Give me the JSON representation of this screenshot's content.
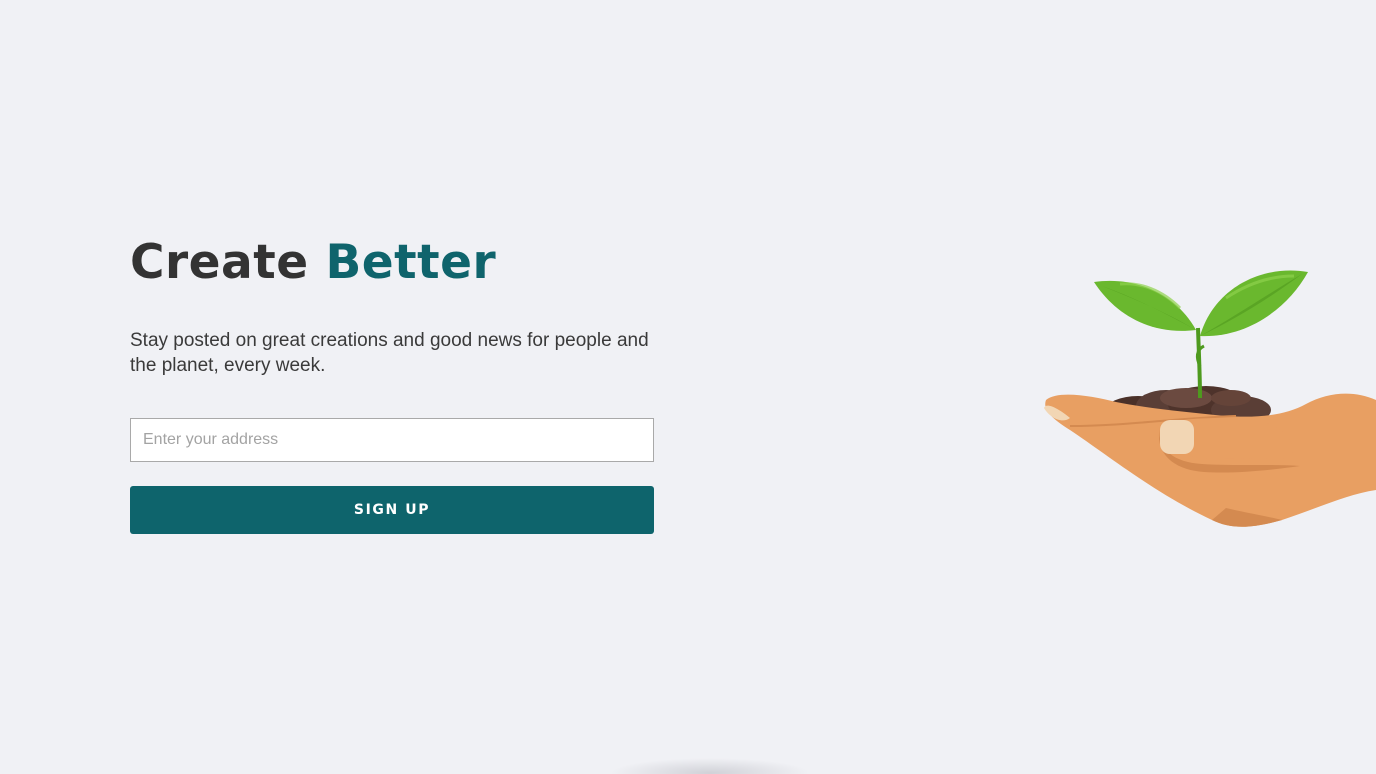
{
  "hero": {
    "title_part1": "Create",
    "title_part2": "Better",
    "subtitle": "Stay posted on great creations and good news for people and the planet, every week."
  },
  "form": {
    "email_placeholder": "Enter your address",
    "email_value": "",
    "signup_label": "SIGN UP"
  },
  "illustration": {
    "icon": "hand-holding-sprout-icon"
  },
  "colors": {
    "background": "#f0f1f5",
    "accent": "#0f646c",
    "button": "#0e646c",
    "text": "#333333",
    "skin": "#e89f62",
    "leaf": "#6ab82e",
    "soil": "#5a3e36"
  }
}
